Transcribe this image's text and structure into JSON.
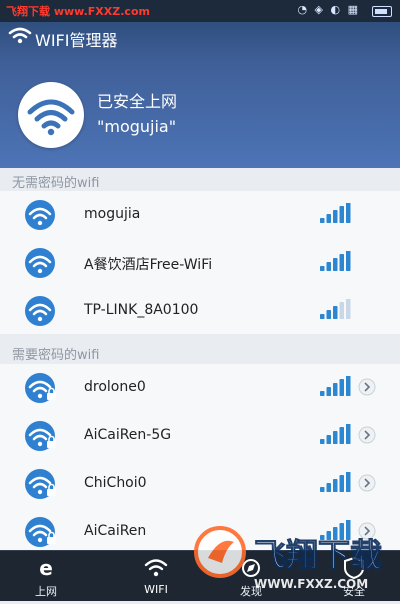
{
  "status_bar": {
    "watermark": "飞翔下载 www.FXXZ.com",
    "icons": "◔ ◈ ◐ ▦",
    "time": ""
  },
  "app": {
    "title": "WIFI管理器"
  },
  "connection": {
    "status": "已安全上网",
    "ssid": "\"mogujia\""
  },
  "sections": {
    "open_title": "无需密码的wifi",
    "secure_title": "需要密码的wifi"
  },
  "open_networks": [
    {
      "name": "mogujia",
      "signal_bars": 5
    },
    {
      "name": "A餐饮酒店Free-WiFi",
      "signal_bars": 5
    },
    {
      "name": "TP-LINK_8A0100",
      "signal_bars": 3
    }
  ],
  "secure_networks": [
    {
      "name": "drolone0",
      "signal_bars": 5
    },
    {
      "name": "AiCaiRen-5G",
      "signal_bars": 5
    },
    {
      "name": "ChiChoi0",
      "signal_bars": 5
    },
    {
      "name": "AiCaiRen",
      "signal_bars": 5
    }
  ],
  "tabs": [
    {
      "label": "上网",
      "icon": "browser-e-icon",
      "active": false
    },
    {
      "label": "WIFI",
      "icon": "wifi-icon",
      "active": true
    },
    {
      "label": "发现",
      "icon": "discover-icon",
      "active": false
    },
    {
      "label": "安全",
      "icon": "shield-icon",
      "active": false
    }
  ],
  "watermark": {
    "text": "飞翔下载",
    "url": "WWW.FXXZ.COM"
  },
  "colors": {
    "accent": "#4d74b6",
    "header_top": "#2f4f7f",
    "signal": "#2c86d0",
    "tabbar": "#1e2632"
  }
}
